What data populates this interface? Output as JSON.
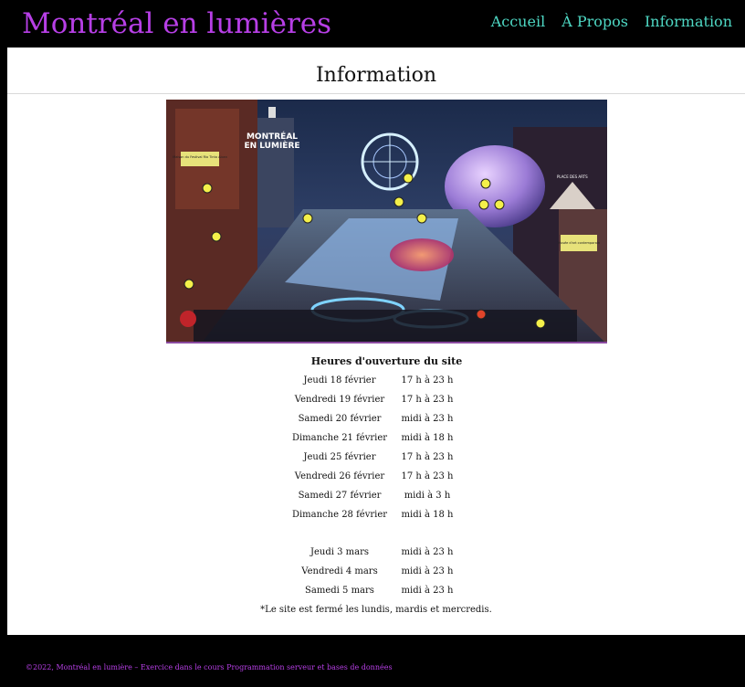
{
  "header": {
    "site_title": "Montréal en lumières",
    "nav": [
      {
        "label": "Accueil"
      },
      {
        "label": "À Propos"
      },
      {
        "label": "Information"
      }
    ]
  },
  "main": {
    "page_title": "Information",
    "map": {
      "logo_line1": "MONTRÉAL",
      "logo_line2": "EN LUMIÈRE",
      "sign_left": "Maison du Festival Rio Tinto Alcan",
      "sign_right": "Musée d'art contemporain",
      "label_place": "PLACE DES ARTS"
    },
    "hours": {
      "title": "Heures d'ouverture du site",
      "rows": [
        {
          "day": "Jeudi 18 février",
          "time": "17 h à 23 h"
        },
        {
          "day": "Vendredi 19 février",
          "time": "17 h à 23 h"
        },
        {
          "day": "Samedi 20 février",
          "time": "midi à 23 h"
        },
        {
          "day": "Dimanche 21 février",
          "time": "midi à 18 h"
        },
        {
          "day": "Jeudi 25 février",
          "time": "17 h à 23 h"
        },
        {
          "day": "Vendredi 26 février",
          "time": "17 h à 23 h"
        },
        {
          "day": "Samedi 27 février",
          "time": "midi à 3 h"
        },
        {
          "day": "Dimanche 28 février",
          "time": "midi à 18 h"
        }
      ],
      "rows_march": [
        {
          "day": "Jeudi 3 mars",
          "time": "midi à 23 h"
        },
        {
          "day": "Vendredi 4 mars",
          "time": "midi à 23 h"
        },
        {
          "day": "Samedi 5 mars",
          "time": "midi à 23 h"
        }
      ],
      "note": "*Le site est fermé les lundis, mardis et mercredis."
    }
  },
  "footer": {
    "text": "©2022, Montréal en lumière – Exercice dans le cours Programmation serveur et bases de données"
  },
  "colors": {
    "title_purple": "#b73fe6",
    "nav_teal": "#4ed8c4",
    "background": "#000000"
  }
}
